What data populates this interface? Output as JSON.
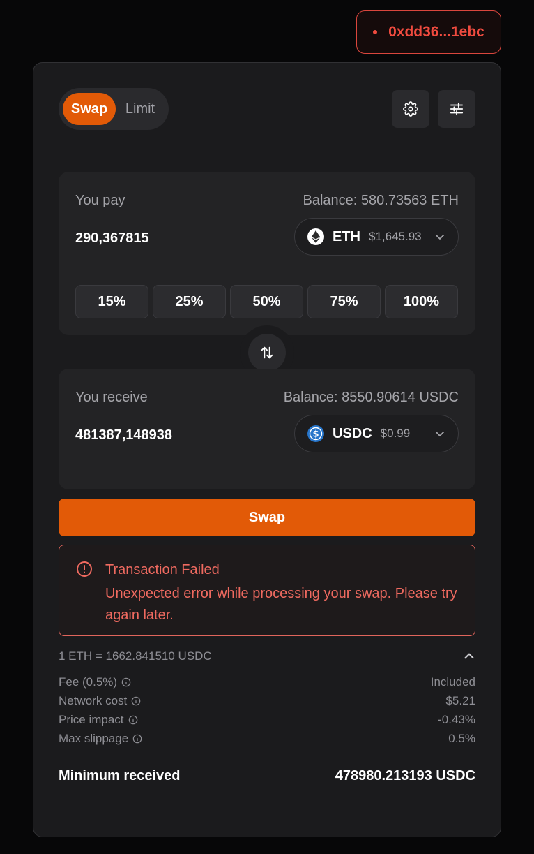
{
  "wallet": {
    "address": "0xdd36...1ebc"
  },
  "tabs": [
    {
      "label": "Swap"
    },
    {
      "label": "Limit"
    }
  ],
  "pay": {
    "label": "You pay",
    "balance": "Balance: 580.73563 ETH",
    "amount": "290,367815",
    "token": {
      "symbol": "ETH",
      "price": "$1,645.93",
      "icon": "ethereum-icon"
    },
    "percent_options": [
      "15%",
      "25%",
      "50%",
      "75%",
      "100%"
    ]
  },
  "receive": {
    "label": "You receive",
    "balance": "Balance: 8550.90614 USDC",
    "amount": "481387,148938",
    "token": {
      "symbol": "USDC",
      "price": "$0.99",
      "icon": "usdc-icon"
    }
  },
  "swap_button": "Swap",
  "error": {
    "title": "Transaction Failed",
    "message": "Unexpected error while processing your swap. Please try again later."
  },
  "rate": "1 ETH = 1662.841510 USDC",
  "details": [
    {
      "label": "Fee (0.5%)",
      "value": "Included"
    },
    {
      "label": "Network cost",
      "value": "$5.21"
    },
    {
      "label": "Price impact",
      "value": "-0.43%"
    },
    {
      "label": "Max slippage",
      "value": "0.5%"
    }
  ],
  "minimum_received": {
    "label": "Minimum received",
    "value": "478980.213193 USDC"
  },
  "colors": {
    "accent": "#e25a07",
    "error": "#ef6a60",
    "background": "#070708",
    "card": "#1b1b1d"
  }
}
